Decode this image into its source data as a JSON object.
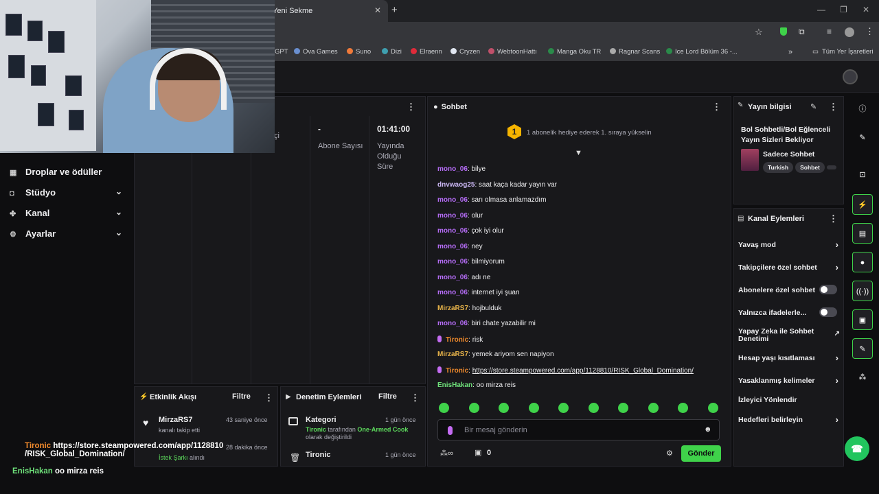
{
  "browser": {
    "tab_title": "Yeni Sekme",
    "bookmarks": [
      "GPT",
      "Ova Games",
      "Suno",
      "Dizi",
      "Elraenn",
      "Cryzen",
      "WebtoonHattı",
      "Manga Oku TR",
      "Ragnar Scans",
      "Ice Lord Bölüm 36 -...",
      "Tüm Yer İşaretleri"
    ]
  },
  "sidebar": {
    "items": [
      {
        "label": "Droplar ve ödüller",
        "icon": "gift-icon"
      },
      {
        "label": "Stüdyo",
        "icon": "studio-icon"
      },
      {
        "label": "Kanal",
        "icon": "channel-icon"
      },
      {
        "label": "Ayarlar",
        "icon": "gear-icon"
      }
    ]
  },
  "stats": {
    "items": [
      {
        "value": "",
        "label": "çi"
      },
      {
        "value": "-",
        "label": "Abone Sayısı"
      },
      {
        "value": "01:41:00",
        "label": "Yayında Olduğu Süre"
      }
    ]
  },
  "activity": {
    "title": "Etkinlik Akışı",
    "filter": "Filtre",
    "events": [
      {
        "name": "MirzaRS7",
        "sub": "kanalı takip etti",
        "time": "43 saniye önce"
      },
      {
        "name": "",
        "sub_highlight": "İstek Şarkı",
        "sub": "alındı",
        "time": "28 dakika önce"
      }
    ]
  },
  "moderation": {
    "title": "Denetim Eylemleri",
    "filter": "Filtre",
    "events": [
      {
        "name": "Kategori",
        "actor": "Tironic",
        "middle": "tarafından",
        "target": "One-Armed Cook",
        "tail": "olarak değiştirildi",
        "time": "1 gün önce"
      },
      {
        "name": "Tironic",
        "time": "1 gün önce"
      }
    ]
  },
  "chat": {
    "title": "Sohbet",
    "banner_badge": "1",
    "banner_text": "1 abonelik hediye ederek 1. sıraya yükselin",
    "messages": [
      {
        "user": "mono_06",
        "text": "bilye",
        "color": "#b46cf5"
      },
      {
        "user": "dnvwaog25",
        "text": "saat kaça kadar yayın var",
        "color": "#c9b6f2"
      },
      {
        "user": "mono_06",
        "text": "sarı olmasa anlamazdım",
        "color": "#b46cf5"
      },
      {
        "user": "mono_06",
        "text": "olur",
        "color": "#b46cf5"
      },
      {
        "user": "mono_06",
        "text": "çok iyi olur",
        "color": "#b46cf5"
      },
      {
        "user": "mono_06",
        "text": "ney",
        "color": "#b46cf5"
      },
      {
        "user": "mono_06",
        "text": "bilmiyorum",
        "color": "#b46cf5"
      },
      {
        "user": "mono_06",
        "text": "adı ne",
        "color": "#b46cf5"
      },
      {
        "user": "mono_06",
        "text": "internet iyi şuan",
        "color": "#b46cf5"
      },
      {
        "user": "MirzaRS7",
        "text": "hojbulduk",
        "color": "#e8b44a"
      },
      {
        "user": "mono_06",
        "text": "biri chate yazabilir mi",
        "color": "#b46cf5"
      },
      {
        "user": "Tironic",
        "text": "risk",
        "color": "#f08a2c",
        "mic": true
      },
      {
        "user": "MirzaRS7",
        "text": "yemek ariyom sen napiyon",
        "color": "#e8b44a"
      },
      {
        "user": "Tironic",
        "text": "https://store.steampowered.com/app/1128810/RISK_Global_Domination/",
        "color": "#f08a2c",
        "mic": true,
        "link": true
      },
      {
        "user": "EnisHakan",
        "text": "oo mirza reis",
        "color": "#6ee07a"
      }
    ],
    "input_placeholder": "Bir mesaj gönderin",
    "points": "0",
    "send_label": "Gönder"
  },
  "stream_info": {
    "title": "Yayın bilgisi",
    "stream_title": "Bol Sohbetli/Bol Eğlenceli Yayın Sizleri Bekliyor",
    "category": "Sadece Sohbet",
    "tags": [
      "Turkish",
      "Sohbet"
    ]
  },
  "channel_actions": {
    "title": "Kanal Eylemleri",
    "items": [
      {
        "label": "Yavaş mod",
        "control": "arrow"
      },
      {
        "label": "Takipçilere özel sohbet",
        "control": "arrow"
      },
      {
        "label": "Abonelere özel sohbet",
        "control": "toggle"
      },
      {
        "label": "Yalnızca ifadelerle...",
        "control": "toggle"
      },
      {
        "label": "Yapay Zeka ile Sohbet Denetimi",
        "control": "external"
      },
      {
        "label": "Hesap yaşı kısıtlaması",
        "control": "arrow"
      },
      {
        "label": "Yasaklanmış kelimeler",
        "control": "arrow"
      },
      {
        "label": "İzleyici Yönlendir",
        "control": "none"
      },
      {
        "label": "Hedefleri belirleyin",
        "control": "arrow"
      }
    ]
  },
  "overlay_chat": [
    {
      "user": "Tironic",
      "text": "https://store.steampowered.com/app/1128810 /RISK_Global_Domination/",
      "color": "#f08a2c"
    },
    {
      "user": "EnisHakan",
      "text": "oo mirza reis",
      "color": "#6ee07a"
    }
  ],
  "colors": {
    "accent": "#3fd24a",
    "sub_color": "#b46cf5"
  }
}
